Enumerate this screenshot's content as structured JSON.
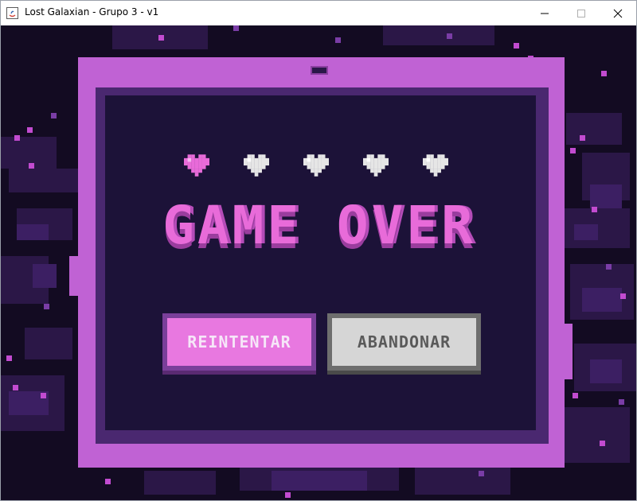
{
  "window": {
    "title": "Lost Galaxian - Grupo 3 - v1",
    "controls": [
      "minimize-icon",
      "maximize-icon",
      "close-icon"
    ]
  },
  "game": {
    "lives": {
      "total": 5,
      "filled": 1,
      "filled_color": "#e86bd9",
      "empty_color": "#e6e6e6"
    },
    "title": "GAME OVER",
    "buttons": {
      "retry_label": "REINTENTAR",
      "quit_label": "ABANDONAR"
    },
    "colors": {
      "frame": "#c062d4",
      "panel": "#1c1238",
      "background": "#130b22"
    }
  }
}
